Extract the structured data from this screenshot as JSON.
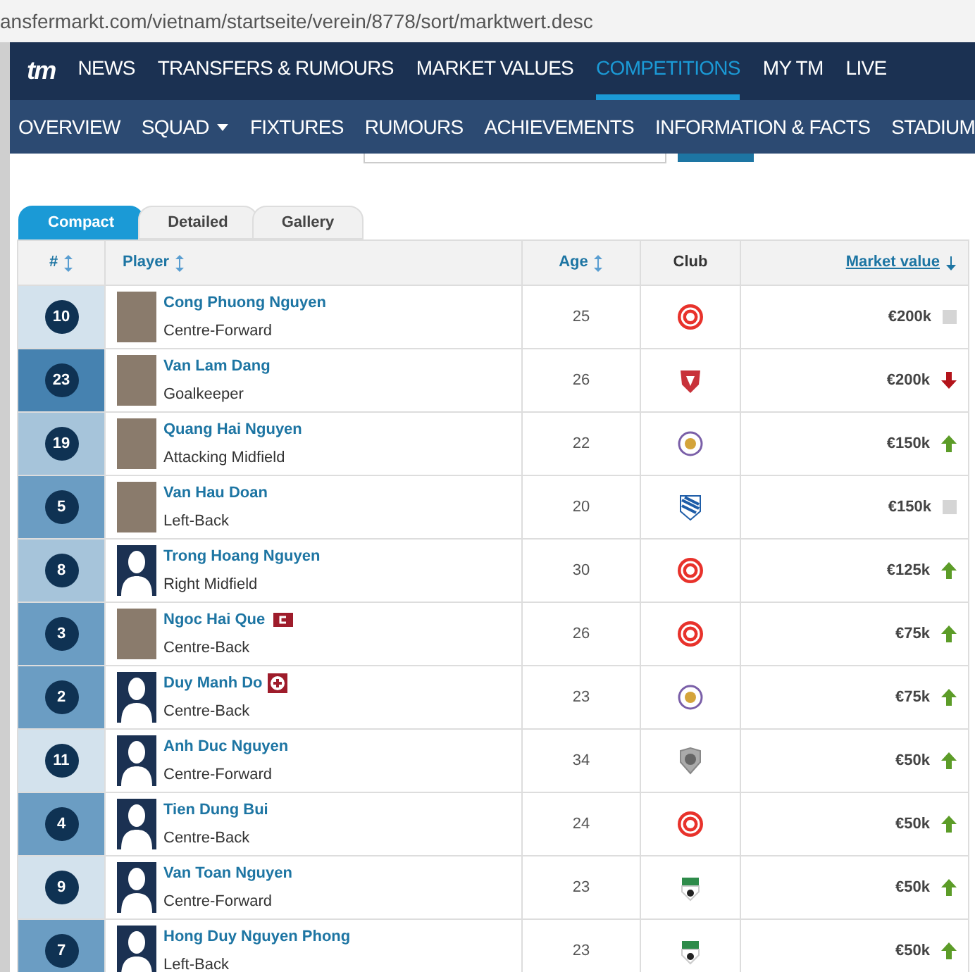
{
  "address_bar": {
    "url": "ansfermarkt.com/vietnam/startseite/verein/8778/sort/marktwert.desc"
  },
  "main_nav": {
    "logo": "tm",
    "items": [
      {
        "label": "NEWS",
        "selected": false
      },
      {
        "label": "TRANSFERS & RUMOURS",
        "selected": false
      },
      {
        "label": "MARKET VALUES",
        "selected": false
      },
      {
        "label": "COMPETITIONS",
        "selected": true
      },
      {
        "label": "MY TM",
        "selected": false
      },
      {
        "label": "LIVE",
        "selected": false
      }
    ]
  },
  "sub_nav": {
    "items": [
      {
        "label": "OVERVIEW",
        "dropdown": false
      },
      {
        "label": "SQUAD",
        "dropdown": true
      },
      {
        "label": "FIXTURES",
        "dropdown": false
      },
      {
        "label": "RUMOURS",
        "dropdown": false
      },
      {
        "label": "ACHIEVEMENTS",
        "dropdown": false
      },
      {
        "label": "INFORMATION & FACTS",
        "dropdown": false
      },
      {
        "label": "STADIUM",
        "dropdown": false
      }
    ]
  },
  "view_tabs": [
    {
      "label": "Compact",
      "selected": true
    },
    {
      "label": "Detailed",
      "selected": false
    },
    {
      "label": "Gallery",
      "selected": false
    }
  ],
  "table": {
    "columns": [
      {
        "label": "#",
        "sortable": true,
        "sorted": false
      },
      {
        "label": "Player",
        "sortable": true,
        "sorted": false
      },
      {
        "label": "Age",
        "sortable": true,
        "sorted": false
      },
      {
        "label": "Club",
        "sortable": false,
        "sorted": false
      },
      {
        "label": "Market value",
        "sortable": true,
        "sorted": true
      }
    ],
    "rows": [
      {
        "number": "10",
        "color": "#d3e2ed",
        "name": "Cong Phuong Nguyen",
        "position": "Centre-Forward",
        "photo": true,
        "captain": false,
        "injured": false,
        "age": "25",
        "club": {
          "kind": "red_round"
        },
        "value": "€200k",
        "trend": {
          "kind": "same"
        }
      },
      {
        "number": "23",
        "color": "#4682b0",
        "name": "Van Lam Dang",
        "position": "Goalkeeper",
        "photo": true,
        "captain": false,
        "injured": false,
        "age": "26",
        "club": {
          "kind": "red_shield"
        },
        "value": "€200k",
        "trend": {
          "kind": "down"
        }
      },
      {
        "number": "19",
        "color": "#a6c4da",
        "name": "Quang Hai Nguyen",
        "position": "Attacking Midfield",
        "photo": true,
        "captain": false,
        "injured": false,
        "age": "22",
        "club": {
          "kind": "purple_round"
        },
        "value": "€150k",
        "trend": {
          "kind": "up"
        }
      },
      {
        "number": "5",
        "color": "#6b9dc3",
        "name": "Van Hau Doan",
        "position": "Left-Back",
        "photo": true,
        "captain": false,
        "injured": false,
        "age": "20",
        "club": {
          "kind": "blue_stripes"
        },
        "value": "€150k",
        "trend": {
          "kind": "same"
        }
      },
      {
        "number": "8",
        "color": "#a6c4da",
        "name": "Trong Hoang Nguyen",
        "position": "Right Midfield",
        "photo": false,
        "captain": false,
        "injured": false,
        "age": "30",
        "club": {
          "kind": "red_round"
        },
        "value": "€125k",
        "trend": {
          "kind": "up"
        }
      },
      {
        "number": "3",
        "color": "#6b9dc3",
        "name": "Ngoc Hai Que",
        "position": "Centre-Back",
        "photo": true,
        "captain": true,
        "injured": false,
        "age": "26",
        "club": {
          "kind": "red_round"
        },
        "value": "€75k",
        "trend": {
          "kind": "up"
        }
      },
      {
        "number": "2",
        "color": "#6b9dc3",
        "name": "Duy Manh Do",
        "position": "Centre-Back",
        "photo": false,
        "captain": false,
        "injured": true,
        "age": "23",
        "club": {
          "kind": "purple_round"
        },
        "value": "€75k",
        "trend": {
          "kind": "up"
        }
      },
      {
        "number": "11",
        "color": "#d3e2ed",
        "name": "Anh Duc Nguyen",
        "position": "Centre-Forward",
        "photo": false,
        "captain": false,
        "injured": false,
        "age": "34",
        "club": {
          "kind": "grey_shield"
        },
        "value": "€50k",
        "trend": {
          "kind": "up"
        }
      },
      {
        "number": "4",
        "color": "#6b9dc3",
        "name": "Tien Dung Bui",
        "position": "Centre-Back",
        "photo": false,
        "captain": false,
        "injured": false,
        "age": "24",
        "club": {
          "kind": "red_round"
        },
        "value": "€50k",
        "trend": {
          "kind": "up"
        }
      },
      {
        "number": "9",
        "color": "#d3e2ed",
        "name": "Van Toan Nguyen",
        "position": "Centre-Forward",
        "photo": false,
        "captain": false,
        "injured": false,
        "age": "23",
        "club": {
          "kind": "green_white"
        },
        "value": "€50k",
        "trend": {
          "kind": "up"
        }
      },
      {
        "number": "7",
        "color": "#6b9dc3",
        "name": "Hong Duy Nguyen Phong",
        "position": "Left-Back",
        "photo": false,
        "captain": false,
        "injured": false,
        "age": "23",
        "club": {
          "kind": "green_white"
        },
        "value": "€50k",
        "trend": {
          "kind": "up"
        }
      }
    ]
  }
}
